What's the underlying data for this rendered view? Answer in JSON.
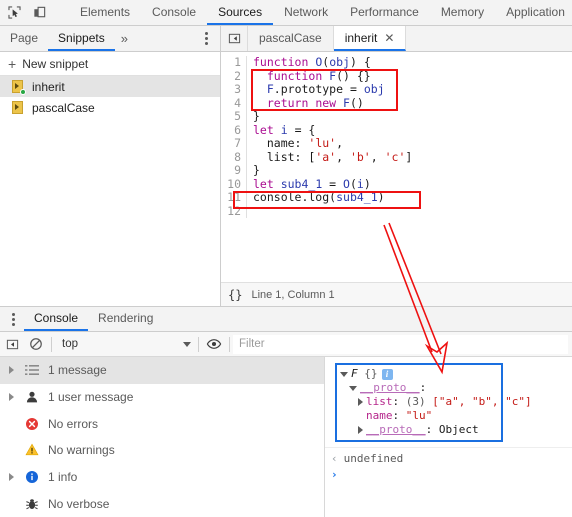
{
  "toolbar": {
    "inspect_icon": "inspect-element-icon",
    "device_icon": "device-toolbar-icon"
  },
  "main_tabs": [
    {
      "label": "Elements",
      "active": false
    },
    {
      "label": "Console",
      "active": false
    },
    {
      "label": "Sources",
      "active": true
    },
    {
      "label": "Network",
      "active": false
    },
    {
      "label": "Performance",
      "active": false
    },
    {
      "label": "Memory",
      "active": false
    },
    {
      "label": "Application",
      "active": false
    }
  ],
  "navigator": {
    "tabs": [
      {
        "label": "Page",
        "active": false
      },
      {
        "label": "Snippets",
        "active": true
      }
    ],
    "more_label": "»",
    "new_snippet_label": "New snippet",
    "plus_glyph": "+",
    "snippets": [
      {
        "label": "inherit",
        "selected": true,
        "has_dot": true
      },
      {
        "label": "pascalCase",
        "selected": false,
        "has_dot": false
      }
    ]
  },
  "editor": {
    "tabs": [
      {
        "label": "pascalCase",
        "active": false,
        "closable": false
      },
      {
        "label": "inherit",
        "active": true,
        "closable": true
      }
    ],
    "close_glyph": "✕",
    "statusbar": {
      "format_label": "{}",
      "position": "Line 1, Column 1"
    },
    "code": [
      {
        "n": "1",
        "tokens": [
          {
            "t": "function ",
            "c": "kw"
          },
          {
            "t": "O",
            "c": "id"
          },
          {
            "t": "(",
            "c": "pl"
          },
          {
            "t": "obj",
            "c": "id"
          },
          {
            "t": ") {",
            "c": "pl"
          }
        ]
      },
      {
        "n": "2",
        "tokens": [
          {
            "t": "  ",
            "c": "pl"
          },
          {
            "t": "function ",
            "c": "kw"
          },
          {
            "t": "F",
            "c": "id"
          },
          {
            "t": "() {}",
            "c": "pl"
          }
        ]
      },
      {
        "n": "3",
        "tokens": [
          {
            "t": "  ",
            "c": "pl"
          },
          {
            "t": "F",
            "c": "id"
          },
          {
            "t": ".prototype = ",
            "c": "pl"
          },
          {
            "t": "obj",
            "c": "id"
          }
        ]
      },
      {
        "n": "4",
        "tokens": [
          {
            "t": "  ",
            "c": "pl"
          },
          {
            "t": "return new ",
            "c": "kw"
          },
          {
            "t": "F",
            "c": "id"
          },
          {
            "t": "()",
            "c": "pl"
          }
        ]
      },
      {
        "n": "5",
        "tokens": [
          {
            "t": "}",
            "c": "pl"
          }
        ]
      },
      {
        "n": "6",
        "tokens": [
          {
            "t": "let ",
            "c": "kw"
          },
          {
            "t": "i",
            "c": "id"
          },
          {
            "t": " = {",
            "c": "pl"
          }
        ]
      },
      {
        "n": "7",
        "tokens": [
          {
            "t": "  name: ",
            "c": "pl"
          },
          {
            "t": "'lu'",
            "c": "str"
          },
          {
            "t": ",",
            "c": "pl"
          }
        ]
      },
      {
        "n": "8",
        "tokens": [
          {
            "t": "  list: [",
            "c": "pl"
          },
          {
            "t": "'a'",
            "c": "str"
          },
          {
            "t": ", ",
            "c": "pl"
          },
          {
            "t": "'b'",
            "c": "str"
          },
          {
            "t": ", ",
            "c": "pl"
          },
          {
            "t": "'c'",
            "c": "str"
          },
          {
            "t": "]",
            "c": "pl"
          }
        ]
      },
      {
        "n": "9",
        "tokens": [
          {
            "t": "}",
            "c": "pl"
          }
        ]
      },
      {
        "n": "10",
        "tokens": [
          {
            "t": "let ",
            "c": "kw"
          },
          {
            "t": "sub4_1",
            "c": "id"
          },
          {
            "t": " = ",
            "c": "pl"
          },
          {
            "t": "O",
            "c": "id"
          },
          {
            "t": "(",
            "c": "pl"
          },
          {
            "t": "i",
            "c": "id"
          },
          {
            "t": ")",
            "c": "pl"
          }
        ]
      },
      {
        "n": "11",
        "tokens": [
          {
            "t": "console",
            "c": "pl"
          },
          {
            "t": ".log(",
            "c": "pl"
          },
          {
            "t": "sub4_1",
            "c": "id"
          },
          {
            "t": ")",
            "c": "pl"
          }
        ]
      },
      {
        "n": "12",
        "tokens": [
          {
            "t": "",
            "c": "pl"
          }
        ]
      }
    ]
  },
  "drawer": {
    "tabs": [
      {
        "label": "Console",
        "active": true
      },
      {
        "label": "Rendering",
        "active": false
      }
    ],
    "toolbar": {
      "sidebar_toggle_icon": "console-sidebar-toggle-icon",
      "clear_icon": "clear-console-icon",
      "context_value": "top",
      "eye_icon": "live-expression-icon",
      "filter_placeholder": "Filter",
      "filter_value": ""
    },
    "sidebar": [
      {
        "label": "1 message",
        "icon": "list-icon",
        "arrow": true,
        "selected": true
      },
      {
        "label": "1 user message",
        "icon": "user-icon",
        "arrow": true,
        "selected": false
      },
      {
        "label": "No errors",
        "icon": "error-icon",
        "arrow": false,
        "selected": false
      },
      {
        "label": "No warnings",
        "icon": "warning-icon",
        "arrow": false,
        "selected": false
      },
      {
        "label": "1 info",
        "icon": "info-icon",
        "arrow": true,
        "selected": false
      },
      {
        "label": "No verbose",
        "icon": "bug-icon",
        "arrow": false,
        "selected": false
      }
    ],
    "output": {
      "root_name": "F",
      "root_braces": "{}",
      "info_badge": "i",
      "proto_label": "__proto__",
      "colon": ":",
      "list_key": "list",
      "list_count": "(3)",
      "list_value": "[\"a\", \"b\", \"c\"]",
      "name_key": "name",
      "name_value": "\"lu\"",
      "inner_proto_label": "__proto__",
      "inner_proto_value": "Object",
      "result_value": "undefined",
      "result_arrow": "‹",
      "prompt_glyph": "›"
    }
  },
  "annotations": {
    "accent_red": "#ee1111",
    "accent_blue": "#1a6fe0",
    "arrow_name": "red-annotation-arrow"
  }
}
